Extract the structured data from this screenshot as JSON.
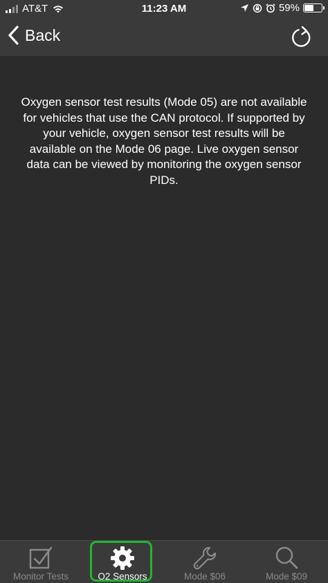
{
  "status_bar": {
    "carrier": "AT&T",
    "time": "11:23 AM",
    "battery_percent": "59%",
    "battery_level": 0.59
  },
  "nav": {
    "back_label": "Back"
  },
  "content": {
    "message": "Oxygen sensor test results (Mode 05) are not available for vehicles that use the CAN protocol. If supported by your vehicle, oxygen sensor test results will be available on the Mode 06 page. Live oxygen sensor data can be viewed by monitoring the oxygen sensor PIDs."
  },
  "tabs": [
    {
      "label": "Monitor Tests",
      "icon": "checkbox-icon",
      "active": false
    },
    {
      "label": "O2 Sensors",
      "icon": "gear-icon",
      "active": true
    },
    {
      "label": "Mode $06",
      "icon": "wrench-icon",
      "active": false
    },
    {
      "label": "Mode $09",
      "icon": "magnifier-icon",
      "active": false
    }
  ],
  "colors": {
    "background": "#2b2b2b",
    "bar": "#3a3a3a",
    "inactive_tab": "#8a8a8a",
    "highlight": "#22b532"
  }
}
